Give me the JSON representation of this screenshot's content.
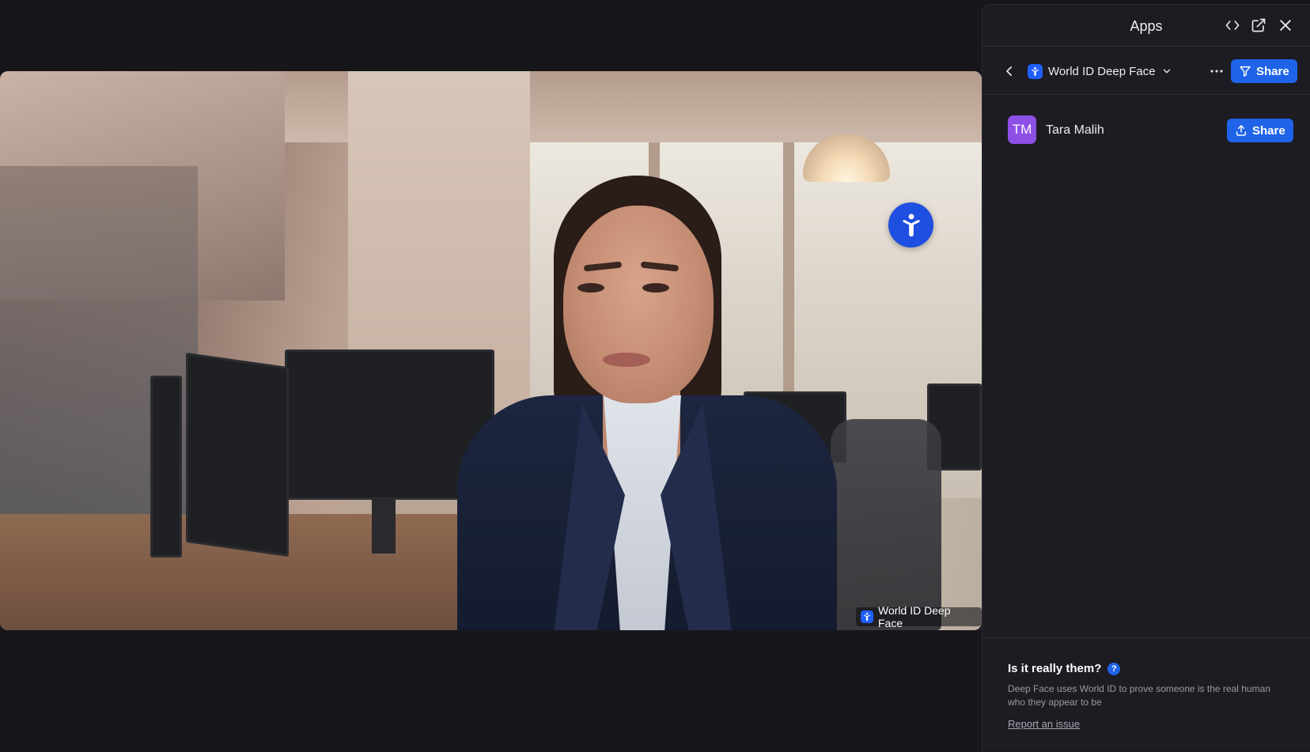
{
  "panel": {
    "title": "Apps",
    "app_name": "World ID Deep Face",
    "share_label": "Share"
  },
  "participant": {
    "initials": "TM",
    "name": "Tara Malih",
    "share_label": "Share"
  },
  "info": {
    "title": "Is it really them?",
    "help_glyph": "?",
    "description": "Deep Face uses World ID to prove someone is the real human who they appear to be",
    "report_link": "Report an issue"
  },
  "video": {
    "label": "World ID Deep Face"
  },
  "colors": {
    "accent": "#1f63e8",
    "avatar": "#8e4fe6",
    "panel_bg": "#1c1c22",
    "stage_bg": "#16161b"
  },
  "icons": {
    "code": "code-icon",
    "popout": "external-link-icon",
    "close": "close-icon",
    "back": "chevron-left-icon",
    "dropdown": "chevron-down-icon",
    "more": "more-horizontal-icon",
    "share": "share-icon",
    "upload": "upload-icon",
    "world_id": "world-id-logo-icon",
    "help": "help-icon"
  }
}
